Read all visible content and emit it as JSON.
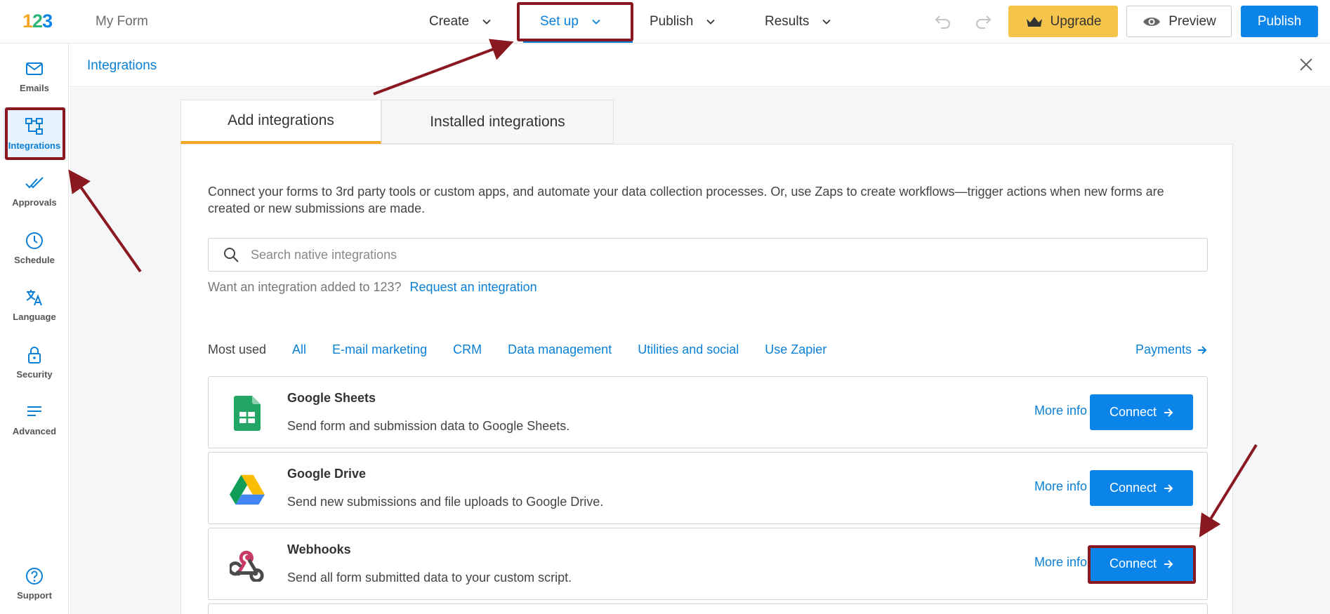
{
  "header": {
    "logo_text": "123",
    "form_name": "My Form",
    "nav": [
      {
        "label": "Create"
      },
      {
        "label": "Set up"
      },
      {
        "label": "Publish"
      },
      {
        "label": "Results"
      }
    ],
    "upgrade_label": "Upgrade",
    "preview_label": "Preview",
    "publish_label": "Publish"
  },
  "sidebar": {
    "items": [
      {
        "label": "Emails",
        "icon": "mail-icon"
      },
      {
        "label": "Integrations",
        "icon": "integrations-icon"
      },
      {
        "label": "Approvals",
        "icon": "approvals-icon"
      },
      {
        "label": "Schedule",
        "icon": "clock-icon"
      },
      {
        "label": "Language",
        "icon": "translate-icon"
      },
      {
        "label": "Security",
        "icon": "lock-icon"
      },
      {
        "label": "Advanced",
        "icon": "lines-icon"
      },
      {
        "label": "Support",
        "icon": "help-icon"
      }
    ]
  },
  "breadcrumb": "Integrations",
  "tabs": [
    {
      "label": "Add integrations"
    },
    {
      "label": "Installed integrations"
    }
  ],
  "intro": "Connect your forms to 3rd party tools or custom apps, and automate your data collection processes. Or, use Zaps to create workflows—trigger actions when new forms are created or new submissions are made.",
  "search": {
    "placeholder": "Search native integrations"
  },
  "request": {
    "text": "Want an integration added to 123?",
    "link": "Request an integration"
  },
  "filters": {
    "label": "Most used",
    "items": [
      "All",
      "E-mail marketing",
      "CRM",
      "Data management",
      "Utilities and social",
      "Use Zapier"
    ],
    "payments": "Payments"
  },
  "integrations": [
    {
      "name": "Google Sheets",
      "desc": "Send form and submission data to Google Sheets.",
      "more": "More info",
      "connect": "Connect"
    },
    {
      "name": "Google Drive",
      "desc": "Send new submissions and file uploads to Google Drive.",
      "more": "More info",
      "connect": "Connect"
    },
    {
      "name": "Webhooks",
      "desc": "Send all form submitted data to your custom script.",
      "more": "More info",
      "connect": "Connect"
    }
  ],
  "colors": {
    "accent": "#0a84e8",
    "upgrade": "#f5c44b",
    "tab_underline": "#f5a623",
    "annotation": "#8a1820"
  }
}
